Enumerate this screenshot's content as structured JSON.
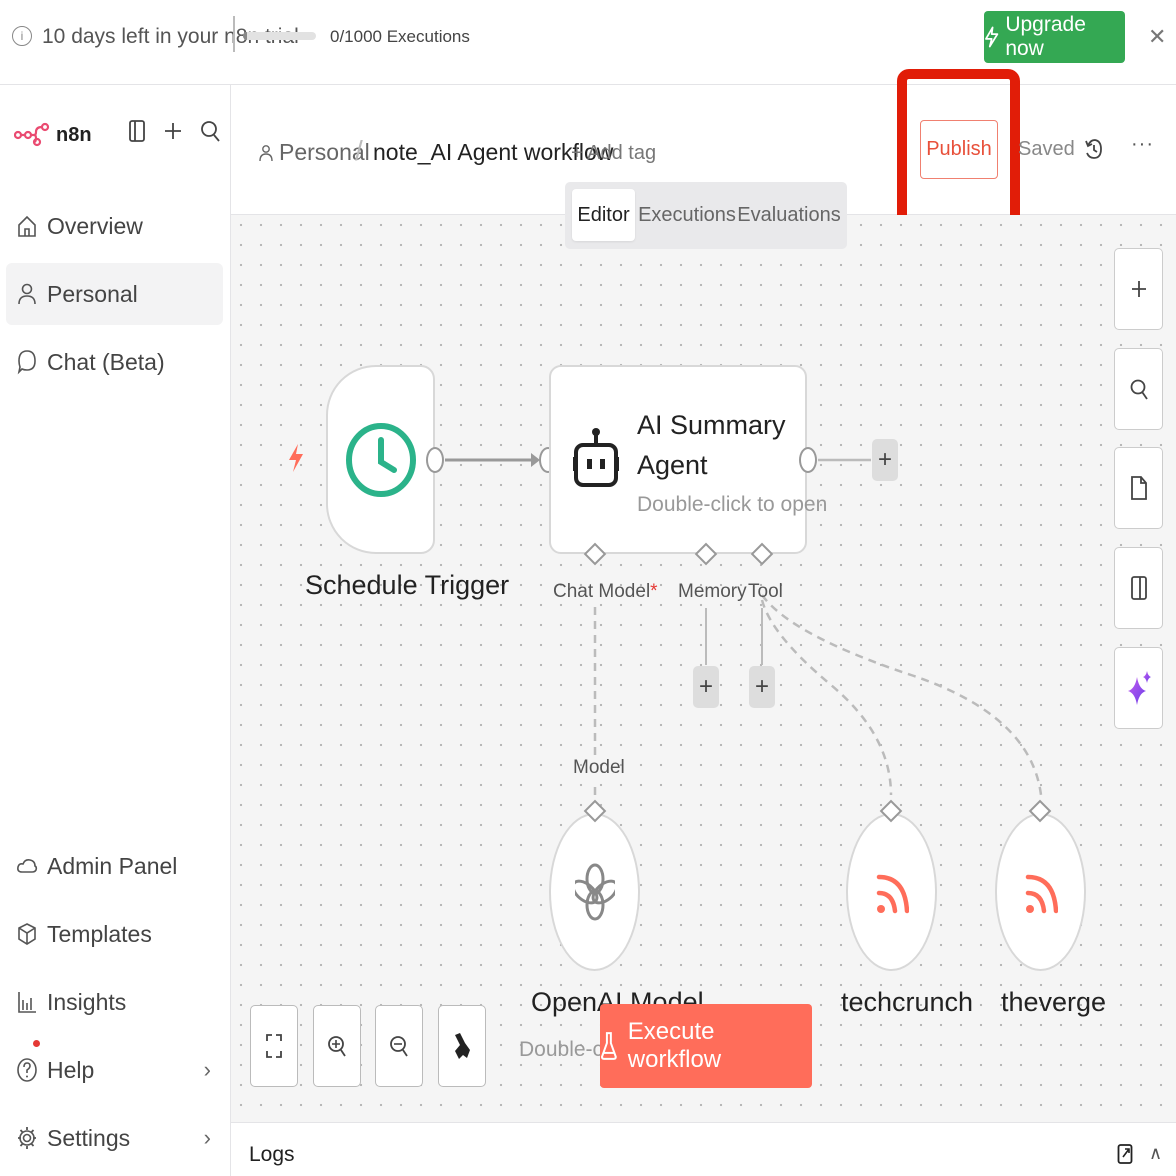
{
  "banner": {
    "trial_text": "10 days left in your n8n trial",
    "executions_text": "0/1000 Executions",
    "executions_progress": 0.0,
    "upgrade_label": "Upgrade now",
    "upgrade_color": "#34a853"
  },
  "sidebar": {
    "brand": "n8n",
    "items": [
      {
        "label": "Overview",
        "icon": "home-icon"
      },
      {
        "label": "Personal",
        "icon": "user-icon",
        "active": true
      },
      {
        "label": "Chat (Beta)",
        "icon": "chat-bubble-icon"
      }
    ],
    "bottom_items": [
      {
        "label": "Admin Panel",
        "icon": "cloud-icon"
      },
      {
        "label": "Templates",
        "icon": "box-icon"
      },
      {
        "label": "Insights",
        "icon": "bar-chart-icon"
      },
      {
        "label": "Help",
        "icon": "help-icon"
      },
      {
        "label": "Settings",
        "icon": "gear-icon"
      }
    ]
  },
  "header": {
    "breadcrumb_project": "Personal",
    "breadcrumb_separator": "/",
    "workflow_name": "note_AI Agent workflow",
    "add_tag": "+ Add tag",
    "publish_label": "Publish",
    "saved_label": "Saved",
    "more_label": "···",
    "tabs": [
      {
        "label": "Editor",
        "active": true
      },
      {
        "label": "Executions"
      },
      {
        "label": "Evaluations"
      }
    ]
  },
  "canvas": {
    "trigger_name": "Schedule Trigger",
    "agent": {
      "title": "AI Summary Agent",
      "subtitle": "Double-click to open",
      "ports": {
        "chat_model": "Chat Model",
        "required_mark": "*",
        "memory": "Memory",
        "tool": "Tool"
      }
    },
    "model_label": "Model",
    "openai": {
      "name": "OpenAI Model",
      "subtitle": "Double-click to open"
    },
    "rss_nodes": [
      {
        "name": "techcrunch"
      },
      {
        "name": "theverge"
      }
    ],
    "plus": "+",
    "execute_label": "Execute workflow",
    "accent": "#ff6d5a"
  },
  "logs": {
    "label": "Logs"
  }
}
